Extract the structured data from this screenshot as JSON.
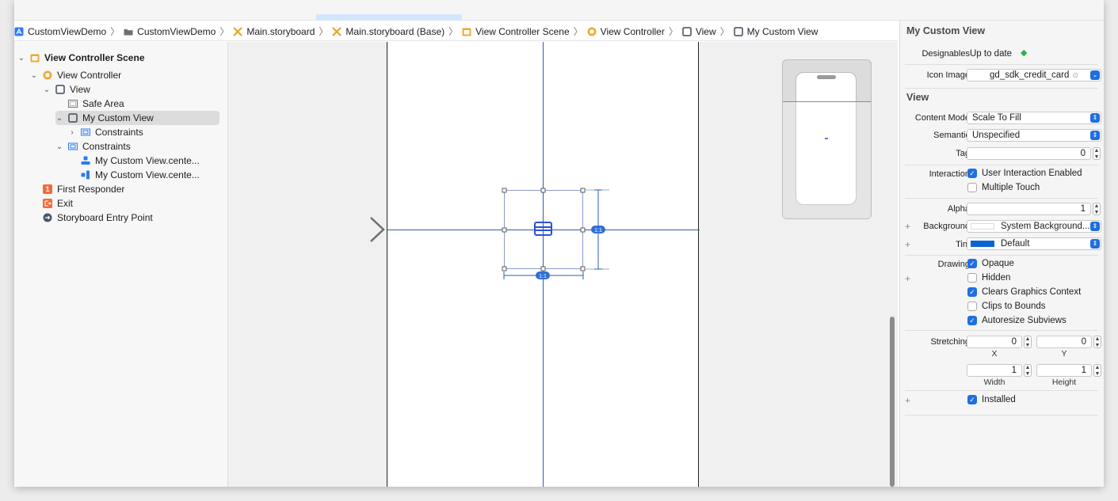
{
  "breadcrumb": {
    "items": [
      {
        "label": "CustomViewDemo",
        "icon": "app-icon"
      },
      {
        "label": "CustomViewDemo",
        "icon": "folder-icon"
      },
      {
        "label": "Main.storyboard",
        "icon": "storyboard-icon"
      },
      {
        "label": "Main.storyboard (Base)",
        "icon": "storyboard-icon"
      },
      {
        "label": "View Controller Scene",
        "icon": "scene-icon"
      },
      {
        "label": "View Controller",
        "icon": "view-controller-icon"
      },
      {
        "label": "View",
        "icon": "view-icon"
      },
      {
        "label": "My Custom View",
        "icon": "view-icon"
      }
    ]
  },
  "outline": {
    "scene": "View Controller Scene",
    "view_controller": "View Controller",
    "view": "View",
    "safe_area": "Safe Area",
    "custom_view": "My Custom View",
    "constraints_inner": "Constraints",
    "constraints": "Constraints",
    "constraint_1": "My Custom View.cente...",
    "constraint_2": "My Custom View.cente...",
    "first_responder": "First Responder",
    "first_responder_badge": "1",
    "exit": "Exit",
    "entry_point": "Storyboard Entry Point"
  },
  "canvas": {
    "constraint_badge_right": "1:1",
    "constraint_badge_bottom": "1:1"
  },
  "inspector": {
    "header": "My Custom View",
    "designables_label": "Designables",
    "designables_value": "Up to date",
    "icon_image_label": "Icon Image",
    "icon_image_value": "gd_sdk_credit_card",
    "view_section": "View",
    "content_mode_label": "Content Mode",
    "content_mode_value": "Scale To Fill",
    "semantic_label": "Semantic",
    "semantic_value": "Unspecified",
    "tag_label": "Tag",
    "tag_value": "0",
    "interaction_label": "Interaction",
    "user_interaction": "User Interaction Enabled",
    "multiple_touch": "Multiple Touch",
    "alpha_label": "Alpha",
    "alpha_value": "1",
    "background_label": "Background",
    "background_value": "System Background...",
    "tint_label": "Tint",
    "tint_value": "Default",
    "drawing_label": "Drawing",
    "opaque": "Opaque",
    "hidden": "Hidden",
    "clears_graphics": "Clears Graphics Context",
    "clips_bounds": "Clips to Bounds",
    "autoresize": "Autoresize Subviews",
    "stretching_label": "Stretching",
    "stretch_x_value": "0",
    "stretch_y_value": "0",
    "stretch_x_label": "X",
    "stretch_y_label": "Y",
    "stretch_w_value": "1",
    "stretch_h_value": "1",
    "stretch_w_label": "Width",
    "stretch_h_label": "Height",
    "installed": "Installed"
  },
  "colors": {
    "accent": "#1f6fe0",
    "tint_swatch": "#0a64d2",
    "constraint": "#2b5fae"
  }
}
